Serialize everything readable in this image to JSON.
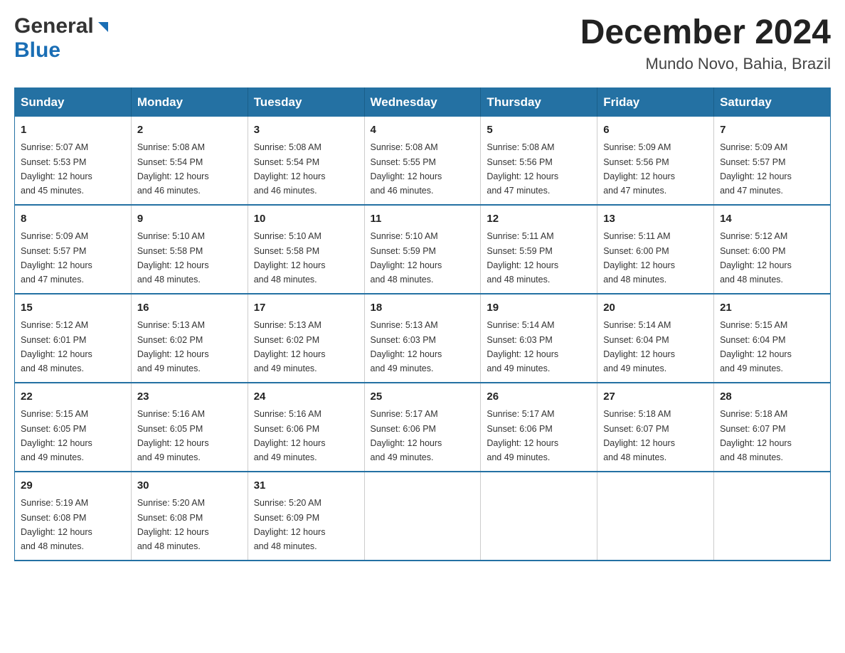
{
  "header": {
    "logo": {
      "general": "General",
      "blue": "Blue"
    },
    "title": "December 2024",
    "location": "Mundo Novo, Bahia, Brazil"
  },
  "days_of_week": [
    "Sunday",
    "Monday",
    "Tuesday",
    "Wednesday",
    "Thursday",
    "Friday",
    "Saturday"
  ],
  "weeks": [
    [
      {
        "day": "1",
        "sunrise": "5:07 AM",
        "sunset": "5:53 PM",
        "daylight": "12 hours and 45 minutes."
      },
      {
        "day": "2",
        "sunrise": "5:08 AM",
        "sunset": "5:54 PM",
        "daylight": "12 hours and 46 minutes."
      },
      {
        "day": "3",
        "sunrise": "5:08 AM",
        "sunset": "5:54 PM",
        "daylight": "12 hours and 46 minutes."
      },
      {
        "day": "4",
        "sunrise": "5:08 AM",
        "sunset": "5:55 PM",
        "daylight": "12 hours and 46 minutes."
      },
      {
        "day": "5",
        "sunrise": "5:08 AM",
        "sunset": "5:56 PM",
        "daylight": "12 hours and 47 minutes."
      },
      {
        "day": "6",
        "sunrise": "5:09 AM",
        "sunset": "5:56 PM",
        "daylight": "12 hours and 47 minutes."
      },
      {
        "day": "7",
        "sunrise": "5:09 AM",
        "sunset": "5:57 PM",
        "daylight": "12 hours and 47 minutes."
      }
    ],
    [
      {
        "day": "8",
        "sunrise": "5:09 AM",
        "sunset": "5:57 PM",
        "daylight": "12 hours and 47 minutes."
      },
      {
        "day": "9",
        "sunrise": "5:10 AM",
        "sunset": "5:58 PM",
        "daylight": "12 hours and 48 minutes."
      },
      {
        "day": "10",
        "sunrise": "5:10 AM",
        "sunset": "5:58 PM",
        "daylight": "12 hours and 48 minutes."
      },
      {
        "day": "11",
        "sunrise": "5:10 AM",
        "sunset": "5:59 PM",
        "daylight": "12 hours and 48 minutes."
      },
      {
        "day": "12",
        "sunrise": "5:11 AM",
        "sunset": "5:59 PM",
        "daylight": "12 hours and 48 minutes."
      },
      {
        "day": "13",
        "sunrise": "5:11 AM",
        "sunset": "6:00 PM",
        "daylight": "12 hours and 48 minutes."
      },
      {
        "day": "14",
        "sunrise": "5:12 AM",
        "sunset": "6:00 PM",
        "daylight": "12 hours and 48 minutes."
      }
    ],
    [
      {
        "day": "15",
        "sunrise": "5:12 AM",
        "sunset": "6:01 PM",
        "daylight": "12 hours and 48 minutes."
      },
      {
        "day": "16",
        "sunrise": "5:13 AM",
        "sunset": "6:02 PM",
        "daylight": "12 hours and 49 minutes."
      },
      {
        "day": "17",
        "sunrise": "5:13 AM",
        "sunset": "6:02 PM",
        "daylight": "12 hours and 49 minutes."
      },
      {
        "day": "18",
        "sunrise": "5:13 AM",
        "sunset": "6:03 PM",
        "daylight": "12 hours and 49 minutes."
      },
      {
        "day": "19",
        "sunrise": "5:14 AM",
        "sunset": "6:03 PM",
        "daylight": "12 hours and 49 minutes."
      },
      {
        "day": "20",
        "sunrise": "5:14 AM",
        "sunset": "6:04 PM",
        "daylight": "12 hours and 49 minutes."
      },
      {
        "day": "21",
        "sunrise": "5:15 AM",
        "sunset": "6:04 PM",
        "daylight": "12 hours and 49 minutes."
      }
    ],
    [
      {
        "day": "22",
        "sunrise": "5:15 AM",
        "sunset": "6:05 PM",
        "daylight": "12 hours and 49 minutes."
      },
      {
        "day": "23",
        "sunrise": "5:16 AM",
        "sunset": "6:05 PM",
        "daylight": "12 hours and 49 minutes."
      },
      {
        "day": "24",
        "sunrise": "5:16 AM",
        "sunset": "6:06 PM",
        "daylight": "12 hours and 49 minutes."
      },
      {
        "day": "25",
        "sunrise": "5:17 AM",
        "sunset": "6:06 PM",
        "daylight": "12 hours and 49 minutes."
      },
      {
        "day": "26",
        "sunrise": "5:17 AM",
        "sunset": "6:06 PM",
        "daylight": "12 hours and 49 minutes."
      },
      {
        "day": "27",
        "sunrise": "5:18 AM",
        "sunset": "6:07 PM",
        "daylight": "12 hours and 48 minutes."
      },
      {
        "day": "28",
        "sunrise": "5:18 AM",
        "sunset": "6:07 PM",
        "daylight": "12 hours and 48 minutes."
      }
    ],
    [
      {
        "day": "29",
        "sunrise": "5:19 AM",
        "sunset": "6:08 PM",
        "daylight": "12 hours and 48 minutes."
      },
      {
        "day": "30",
        "sunrise": "5:20 AM",
        "sunset": "6:08 PM",
        "daylight": "12 hours and 48 minutes."
      },
      {
        "day": "31",
        "sunrise": "5:20 AM",
        "sunset": "6:09 PM",
        "daylight": "12 hours and 48 minutes."
      },
      null,
      null,
      null,
      null
    ]
  ],
  "labels": {
    "sunrise": "Sunrise:",
    "sunset": "Sunset:",
    "daylight": "Daylight:"
  }
}
